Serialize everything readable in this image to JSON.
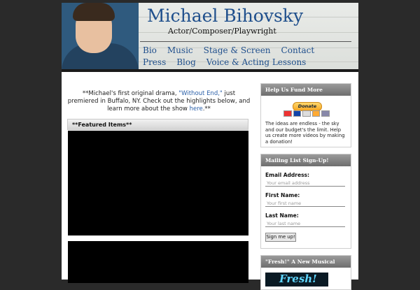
{
  "header": {
    "site_title": "Michael Bihovsky",
    "tagline": "Actor/Composer/Playwright",
    "nav": [
      "Bio",
      "Music",
      "Stage & Screen",
      "Contact",
      "Press",
      "Blog",
      "Voice & Acting Lessons"
    ]
  },
  "main": {
    "intro_before": "**Michael's first original drama, ",
    "intro_link": "\"Without End,\"",
    "intro_middle": " just premiered in Buffalo, NY. Check out the highlights below, and learn more about the show ",
    "intro_here": "here",
    "intro_after": ".**",
    "featured_heading": "**Featured Items**"
  },
  "sidebar": {
    "fund": {
      "heading": "Help Us Fund More Projects!",
      "donate_label": "Donate",
      "blurb": "The ideas are endless - the sky and our budget's the limit. Help us create more videos by making a donation!"
    },
    "mailing": {
      "heading": "Mailing List Sign-Up!",
      "email_label": "Email Address:",
      "email_placeholder": "Your email address",
      "first_label": "First Name:",
      "first_placeholder": "Your first name",
      "last_label": "Last Name:",
      "last_placeholder": "Your last name",
      "submit_label": "Sign me up!"
    },
    "fresh": {
      "heading": "\"Fresh!\" A New Musical",
      "poster_text": "Fresh!"
    }
  },
  "colors": {
    "link": "#1f4f8c",
    "background": "#2a2a2a"
  }
}
